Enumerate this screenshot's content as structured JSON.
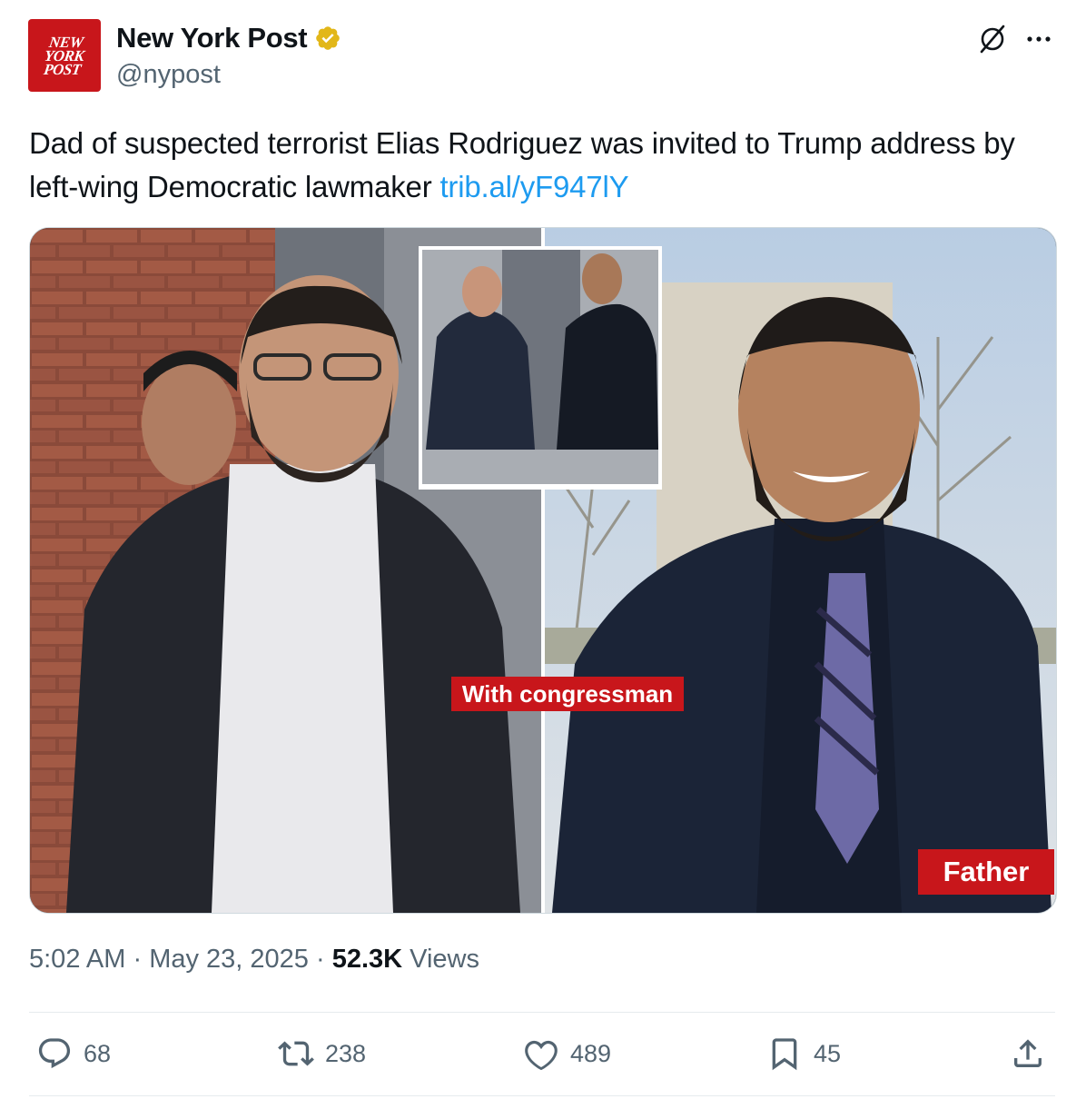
{
  "author": {
    "logo_text": "NEW YORK POST",
    "display_name": "New York Post",
    "handle": "@nypost",
    "verified": true
  },
  "tweet": {
    "text": "Dad of suspected terrorist Elias Rodriguez was invited to Trump address by left-wing Democratic lawmaker ",
    "link": "trib.al/yF947lY"
  },
  "media": {
    "inset_label": "With congressman",
    "father_label": "Father"
  },
  "meta": {
    "time": "5:02 AM",
    "date": "May 23, 2025",
    "views": "52.3K",
    "views_label": "Views"
  },
  "actions": {
    "replies": "68",
    "reposts": "238",
    "likes": "489",
    "bookmarks": "45"
  },
  "colors": {
    "accent": "#1d9bf0",
    "brand_red": "#c8161b",
    "muted": "#536471",
    "verified_gold": "#e2b719"
  },
  "icons": [
    "grok-icon",
    "more-icon",
    "verified-badge-icon",
    "reply-icon",
    "repost-icon",
    "like-icon",
    "bookmark-icon",
    "share-icon"
  ]
}
